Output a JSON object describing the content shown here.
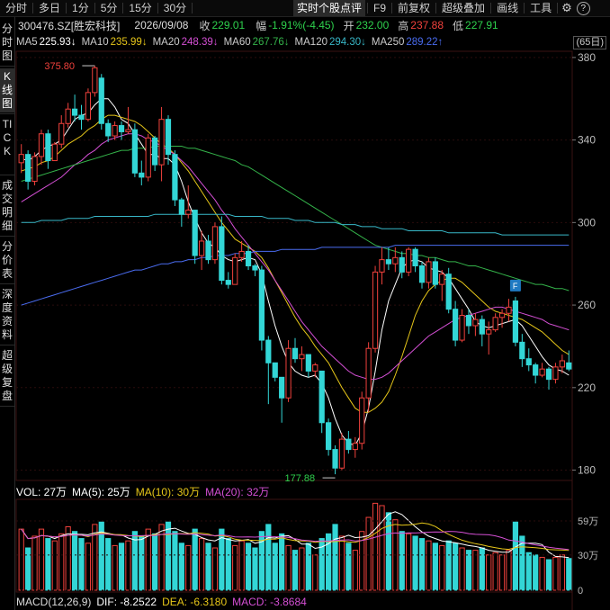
{
  "toolbar": {
    "left": [
      "分时",
      "多日",
      "1分",
      "5分",
      "15分",
      "30分"
    ],
    "right": [
      "实时个股点评",
      "F9",
      "前复权",
      "超级叠加",
      "画线",
      "工具"
    ],
    "help_label": "?"
  },
  "quote": {
    "code_name": "300476.SZ[胜宏科技]",
    "date": "2026/09/08",
    "close_label": "收",
    "close": "229.01",
    "change_label": "幅",
    "change": "-1.91%(-4.45)",
    "open_label": "开",
    "open": "232.00",
    "high_label": "高",
    "high": "237.88",
    "low_label": "低",
    "low": "227.91"
  },
  "ma": [
    {
      "label": "MA5",
      "value": "225.93↓",
      "color": "#ffffff"
    },
    {
      "label": "MA10",
      "value": "235.99↓",
      "color": "#e6c619"
    },
    {
      "label": "MA20",
      "value": "248.39↓",
      "color": "#d44fd4"
    },
    {
      "label": "MA60",
      "value": "267.76↓",
      "color": "#34b34a"
    },
    {
      "label": "MA120",
      "value": "294.30↓",
      "color": "#38b8c8"
    },
    {
      "label": "MA250",
      "value": "289.22↑",
      "color": "#4a6cf0"
    }
  ],
  "days_badge": "(65日)",
  "left_tabs": [
    "分时图",
    "K线图",
    "TICK",
    "成交明细",
    "分价表",
    "深度资料",
    "超级复盘"
  ],
  "chart_data": [
    {
      "type": "candlestick",
      "yticks": [
        380,
        340,
        300,
        260,
        220,
        180
      ],
      "ylim": [
        175,
        383
      ],
      "max_label": "375.80",
      "min_label": "177.88",
      "marker_label": "F",
      "candles": [
        [
          329,
          338,
          324,
          333
        ],
        [
          333,
          335,
          316,
          320
        ],
        [
          320,
          334,
          318,
          332
        ],
        [
          332,
          345,
          328,
          343
        ],
        [
          343,
          345,
          326,
          330
        ],
        [
          330,
          339,
          330,
          338
        ],
        [
          338,
          352,
          336,
          348
        ],
        [
          348,
          358,
          346,
          355
        ],
        [
          355,
          362,
          349,
          352
        ],
        [
          352,
          357,
          345,
          350
        ],
        [
          350,
          365,
          349,
          363
        ],
        [
          363,
          376,
          361,
          375
        ],
        [
          370,
          372,
          345,
          348
        ],
        [
          348,
          350,
          339,
          342
        ],
        [
          342,
          349,
          340,
          347
        ],
        [
          347,
          349,
          340,
          344
        ],
        [
          344,
          356,
          343,
          345
        ],
        [
          345,
          348,
          322,
          324
        ],
        [
          324,
          330,
          318,
          322
        ],
        [
          322,
          343,
          320,
          341
        ],
        [
          341,
          342,
          325,
          328
        ],
        [
          328,
          356,
          320,
          350
        ],
        [
          350,
          352,
          328,
          333
        ],
        [
          333,
          335,
          308,
          311
        ],
        [
          311,
          312,
          298,
          304
        ],
        [
          304,
          318,
          302,
          306
        ],
        [
          306,
          306,
          280,
          284
        ],
        [
          284,
          296,
          277,
          291
        ],
        [
          291,
          294,
          280,
          282
        ],
        [
          282,
          300,
          280,
          298
        ],
        [
          298,
          303,
          270,
          272
        ],
        [
          272,
          276,
          268,
          270
        ],
        [
          270,
          285,
          270,
          283
        ],
        [
          283,
          291,
          281,
          286
        ],
        [
          286,
          289,
          277,
          279
        ],
        [
          279,
          280,
          274,
          277
        ],
        [
          277,
          279,
          238,
          243
        ],
        [
          243,
          245,
          212,
          232
        ],
        [
          232,
          232,
          223,
          225
        ],
        [
          225,
          225,
          203,
          215
        ],
        [
          215,
          243,
          213,
          239
        ],
        [
          239,
          244,
          232,
          234
        ],
        [
          234,
          240,
          228,
          236
        ],
        [
          236,
          236,
          225,
          228
        ],
        [
          228,
          232,
          225,
          231
        ],
        [
          228,
          228,
          198,
          203
        ],
        [
          203,
          205,
          187,
          190
        ],
        [
          190,
          192,
          178,
          181
        ],
        [
          181,
          198,
          180,
          195
        ],
        [
          195,
          199,
          188,
          190
        ],
        [
          190,
          196,
          186,
          193
        ],
        [
          193,
          218,
          190,
          215
        ],
        [
          215,
          242,
          208,
          239
        ],
        [
          239,
          279,
          237,
          276
        ],
        [
          276,
          288,
          270,
          282
        ],
        [
          282,
          288,
          277,
          280
        ],
        [
          280,
          288,
          276,
          283
        ],
        [
          283,
          286,
          273,
          276
        ],
        [
          276,
          288,
          274,
          287
        ],
        [
          287,
          288,
          276,
          279
        ],
        [
          279,
          281,
          268,
          271
        ],
        [
          271,
          283,
          268,
          281
        ],
        [
          281,
          283,
          268,
          270
        ],
        [
          270,
          277,
          262,
          275
        ],
        [
          275,
          278,
          256,
          258
        ],
        [
          258,
          262,
          240,
          243
        ],
        [
          243,
          258,
          242,
          255
        ],
        [
          255,
          258,
          246,
          250
        ],
        [
          250,
          256,
          245,
          253
        ],
        [
          253,
          255,
          240,
          246
        ],
        [
          246,
          252,
          236,
          248
        ],
        [
          248,
          256,
          247,
          254
        ],
        [
          254,
          258,
          249,
          256
        ],
        [
          256,
          263,
          252,
          259
        ],
        [
          262,
          264,
          240,
          242
        ],
        [
          242,
          246,
          230,
          234
        ],
        [
          234,
          239,
          228,
          231
        ],
        [
          231,
          232,
          222,
          226
        ],
        [
          226,
          232,
          225,
          229
        ],
        [
          229,
          230,
          219,
          224
        ],
        [
          224,
          232,
          222,
          230
        ],
        [
          230,
          236,
          227,
          233
        ],
        [
          232,
          238,
          228,
          229
        ]
      ],
      "ma_series": {
        "MA5": [
          331,
          330,
          332,
          335,
          337,
          338,
          340,
          345,
          350,
          352,
          353,
          357,
          360,
          360,
          356,
          350,
          348,
          343,
          338,
          333,
          333,
          331,
          331,
          328,
          320,
          310,
          302,
          295,
          290,
          288,
          284,
          282,
          281,
          282,
          283,
          282,
          275,
          262,
          250,
          240,
          232,
          228,
          226,
          225,
          226,
          222,
          215,
          205,
          197,
          193,
          192,
          198,
          210,
          228,
          248,
          262,
          270,
          278,
          281,
          282,
          281,
          278,
          277,
          276,
          273,
          268,
          263,
          258,
          252,
          250,
          249,
          250,
          251,
          252,
          253,
          250,
          245,
          240,
          235,
          231,
          229,
          228,
          226
        ],
        "MA10": [
          325,
          326,
          327,
          329,
          330,
          332,
          335,
          338,
          340,
          342,
          345,
          347,
          350,
          352,
          352,
          351,
          350,
          349,
          347,
          344,
          341,
          338,
          336,
          333,
          329,
          325,
          320,
          315,
          310,
          305,
          300,
          296,
          292,
          290,
          288,
          286,
          283,
          278,
          272,
          266,
          260,
          254,
          249,
          245,
          240,
          236,
          232,
          226,
          220,
          215,
          210,
          208,
          208,
          210,
          213,
          218,
          226,
          235,
          245,
          255,
          262,
          267,
          270,
          272,
          273,
          273,
          271,
          268,
          265,
          262,
          259,
          257,
          256,
          255,
          254,
          253,
          251,
          249,
          247,
          244,
          241,
          238,
          236
        ],
        "MA20": [
          310,
          312,
          314,
          316,
          318,
          320,
          322,
          325,
          328,
          330,
          333,
          335,
          338,
          340,
          341,
          342,
          343,
          343,
          342,
          340,
          339,
          337,
          335,
          333,
          330,
          327,
          323,
          319,
          315,
          311,
          306,
          302,
          297,
          293,
          289,
          285,
          281,
          277,
          272,
          267,
          262,
          257,
          252,
          248,
          244,
          240,
          237,
          234,
          231,
          228,
          226,
          225,
          224,
          224,
          225,
          227,
          230,
          233,
          236,
          239,
          242,
          245,
          247,
          249,
          251,
          253,
          254,
          255,
          256,
          257,
          258,
          259,
          259,
          258,
          257,
          256,
          255,
          254,
          253,
          251,
          250,
          249,
          248
        ],
        "MA60": [
          320,
          321,
          322,
          323,
          324,
          325,
          326,
          327,
          328,
          329,
          330,
          331,
          332,
          333,
          334,
          335,
          335,
          336,
          336,
          336,
          337,
          337,
          337,
          337,
          337,
          336,
          336,
          335,
          334,
          333,
          332,
          331,
          330,
          328,
          327,
          325,
          323,
          321,
          319,
          317,
          315,
          313,
          311,
          309,
          307,
          305,
          303,
          301,
          299,
          297,
          295,
          293,
          291,
          289,
          288,
          287,
          286,
          285,
          285,
          284,
          284,
          283,
          283,
          282,
          281,
          281,
          280,
          279,
          279,
          278,
          277,
          276,
          275,
          274,
          273,
          272,
          271,
          270,
          270,
          269,
          268,
          268,
          267
        ],
        "MA120": [
          300,
          300,
          300,
          301,
          301,
          301,
          301,
          302,
          302,
          302,
          302,
          303,
          303,
          303,
          303,
          303,
          303,
          303,
          303,
          303,
          304,
          304,
          304,
          304,
          304,
          304,
          304,
          304,
          304,
          304,
          304,
          304,
          303,
          303,
          303,
          303,
          303,
          302,
          302,
          302,
          302,
          301,
          301,
          301,
          300,
          300,
          300,
          300,
          299,
          299,
          299,
          298,
          298,
          298,
          297,
          297,
          297,
          297,
          296,
          296,
          296,
          296,
          296,
          296,
          295,
          295,
          295,
          295,
          295,
          295,
          295,
          295,
          294,
          294,
          294,
          294,
          294,
          294,
          294,
          294,
          294,
          294,
          294
        ],
        "MA250": [
          260,
          261,
          262,
          263,
          264,
          265,
          266,
          267,
          268,
          269,
          270,
          271,
          272,
          273,
          274,
          275,
          276,
          277,
          277,
          278,
          279,
          280,
          280,
          281,
          281,
          282,
          282,
          283,
          283,
          284,
          284,
          284,
          285,
          285,
          285,
          286,
          286,
          286,
          286,
          287,
          287,
          287,
          287,
          287,
          287,
          288,
          288,
          288,
          288,
          288,
          288,
          288,
          288,
          288,
          288,
          288,
          289,
          289,
          289,
          289,
          289,
          289,
          289,
          289,
          289,
          289,
          289,
          289,
          289,
          289,
          289,
          289,
          289,
          289,
          289,
          289,
          289,
          289,
          289,
          289,
          289,
          289,
          289
        ]
      }
    },
    {
      "type": "bar",
      "title": "VOL",
      "labels": {
        "vol": "VOL: 27万",
        "ma5": "MA(5): 25万",
        "ma10": "MA(10): 30万",
        "ma20": "MA(20): 32万"
      },
      "yticks_labels": [
        "59万",
        "30万",
        "0"
      ],
      "yticks": [
        59,
        30,
        0
      ],
      "ylim": [
        0,
        72
      ],
      "values": [
        52,
        36,
        46,
        52,
        44,
        42,
        48,
        54,
        50,
        44,
        40,
        56,
        58,
        44,
        38,
        40,
        42,
        50,
        46,
        52,
        48,
        56,
        58,
        50,
        40,
        38,
        52,
        44,
        40,
        36,
        52,
        44,
        38,
        42,
        40,
        36,
        50,
        56,
        40,
        48,
        38,
        34,
        36,
        40,
        30,
        44,
        48,
        56,
        46,
        40,
        34,
        50,
        62,
        74,
        72,
        66,
        60,
        50,
        48,
        46,
        44,
        42,
        40,
        38,
        42,
        40,
        36,
        34,
        34,
        36,
        30,
        32,
        30,
        34,
        58,
        46,
        32,
        30,
        28,
        26,
        28,
        30,
        27
      ]
    },
    {
      "type": "line",
      "title": "MACD",
      "labels": {
        "name": "MACD(12,26,9)",
        "dif": "DIF: -8.2522",
        "dea": "DEA: -6.3180",
        "macd": "MACD: -3.8684"
      }
    }
  ]
}
